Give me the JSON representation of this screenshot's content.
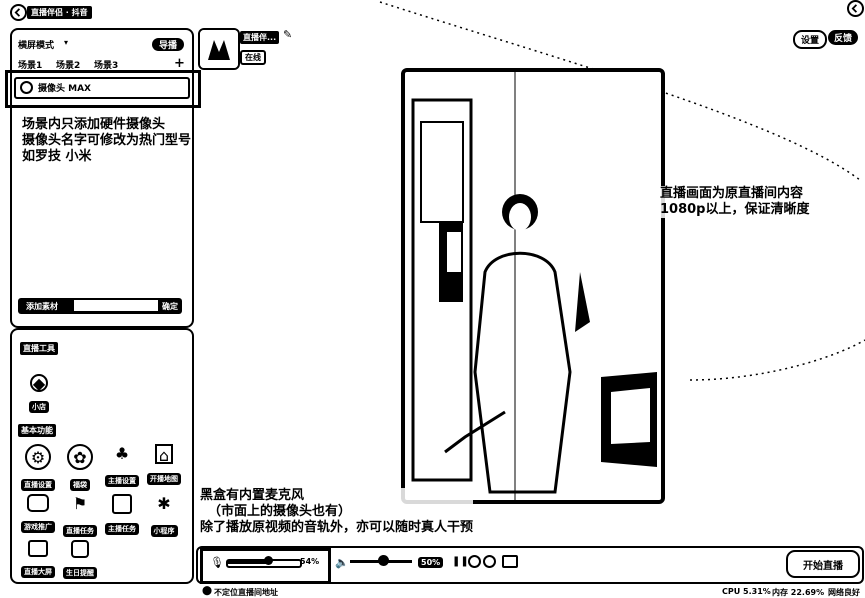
{
  "header": {
    "title": "直播伴侣 · 抖音"
  },
  "left_panel": {
    "mode_label": "横屏模式",
    "mode_button": "导播",
    "scene_tabs": [
      "场景1",
      "场景2",
      "场景3"
    ],
    "add_tab": "+",
    "source_item": "摄像头 MAX",
    "add_material_label": "添加素材",
    "add_material_btn": "确定"
  },
  "profile": {
    "name": "直播伴...",
    "tag": "在线"
  },
  "top_right": {
    "btn1": "设置",
    "btn2": "反馈"
  },
  "annotations": {
    "left": [
      "场景内只添加硬件摄像头",
      "摄像头名字可修改为热门型号",
      "如罗技 小米"
    ],
    "right": [
      "直播画面为原直播间内容",
      "1080p以上，保证清晰度"
    ],
    "bottom": [
      "黑盒有内置麦克风",
      "（市面上的摄像头也有）",
      "除了播放原视频的音轨外，亦可以随时真人干预"
    ]
  },
  "tools_panel": {
    "title": "直播工具",
    "main_tool": "小店",
    "section2": "基本功能",
    "tools": [
      "直播设置",
      "福袋",
      "主播设置",
      "开播地图",
      "游戏推广",
      "直播任务",
      "主播任务",
      "小程序",
      "直播大屏",
      "生日提醒"
    ]
  },
  "audio": {
    "mic_value": "54%",
    "volume_value": "50%"
  },
  "start_button": "开始直播",
  "status": {
    "left_text": "不定位直播间地址",
    "cpu": "CPU 5.31%",
    "mem": "内存 22.69%",
    "net": "网络良好"
  }
}
